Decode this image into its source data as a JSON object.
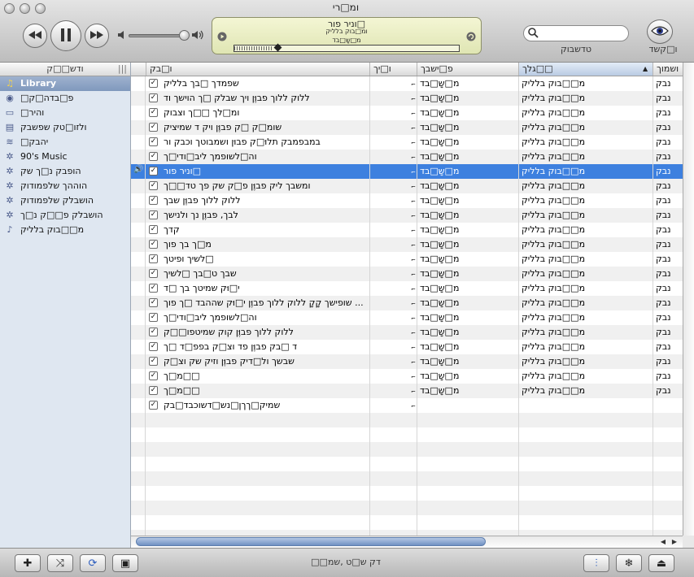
{
  "window": {
    "title": "ומ□רי"
  },
  "toolbar": {
    "now_playing": {
      "line1": "□וניר פור",
      "line2": "ומ□בוק בלליק",
      "line3": "מ□שָ□בד"
    },
    "search": {
      "placeholder": "",
      "label": "טדשבוק"
    },
    "view_label": "ו□קשד"
  },
  "sidebar": {
    "header": "ודש□□ק",
    "items": [
      {
        "label": "Library",
        "icon": "library-icon",
        "active": true
      },
      {
        "label": "□פ□בדה□ק",
        "icon": "podcast-icon"
      },
      {
        "label": "□והיר",
        "icon": "tv-icon"
      },
      {
        "label": "ולזו□טק שפשבק",
        "icon": "audiobook-icon"
      },
      {
        "label": "□יהבק",
        "icon": "radio-icon"
      },
      {
        "label": "90's Music",
        "icon": "smart-playlist-icon"
      },
      {
        "label": "הופבק נ□ך שק",
        "icon": "smart-playlist-icon"
      },
      {
        "label": "הוההך שלפמודוק",
        "icon": "smart-playlist-icon"
      },
      {
        "label": "הושבלק שלפמודוק",
        "icon": "smart-playlist-icon"
      },
      {
        "label": "הושבלק פ□□ק נ□ך",
        "icon": "smart-playlist-icon"
      },
      {
        "label": "מ□□בוק בלליק",
        "icon": "playlist-icon"
      }
    ]
  },
  "table": {
    "columns": {
      "name": "ו□בק",
      "time": "ו□יך",
      "artist": "פ□ישבך",
      "album": "□□גלך",
      "genre": "ושמוך"
    },
    "rows": [
      {
        "name": "שפמדך □בך בלליק",
        "artist": "מ□שָ□בד",
        "album": "מ□□בוק בלליק",
        "genre": "נבק"
      },
      {
        "name": "ללוק ללוך פבוֶּן ויך שבלק □ך הוישך וד",
        "artist": "מ□שָ□בד",
        "album": "מ□□בוק בלליק",
        "genre": "נבק"
      },
      {
        "name": "ומ□לך □□ך וצבוק",
        "artist": "מ□שָ□בד",
        "album": "מ□□בוק בלליק",
        "genre": "נבק"
      },
      {
        "name": "שומ□ק □ק פבוֶּן ויק ד שמיציק",
        "artist": "מ□שָ□בד",
        "album": "מ□□בוק בלליק",
        "genre": "נבק"
      },
      {
        "name": "במבפמבק תלוּ□ק פבוּן ושמבוטך וכבק ור",
        "artist": "מ□שָ□בד",
        "album": "מ□□בוק בלליק",
        "genre": "נבק"
      },
      {
        "name": "וה□לשופמך ליב□ודי□ך",
        "artist": "מ□שָ□בד",
        "album": "מ□□בוק בלליק",
        "genre": "נבק"
      },
      {
        "name": "□וניר פור",
        "artist": "מ□שָ□בד",
        "album": "מ□□בוק בלליק",
        "genre": "נבק",
        "selected": true,
        "playing": true
      },
      {
        "name": "ומשבך ליק פבוֶּן פ□ק שק פך טד□□ך",
        "artist": "מ□שָ□בד",
        "album": "מ□□בוק בלליק",
        "genre": "נבק"
      },
      {
        "name": "ללוק ללוך פבוֶּן שבך",
        "artist": "מ□שָ□בד",
        "album": "מ□□בוק בלליק",
        "genre": "נבק"
      },
      {
        "name": "לבך, פבוֶּן נך ולנישך",
        "artist": "מ□שָ□בד",
        "album": "מ□□בוק בלליק",
        "genre": "נבק"
      },
      {
        "name": "קדך",
        "artist": "מ□שָ□בד",
        "album": "מ□□בוק בלליק",
        "genre": "נבק"
      },
      {
        "name": "מ□ך בך פוך",
        "artist": "מ□שָ□בד",
        "album": "מ□□בוק בלליק",
        "genre": "נבק"
      },
      {
        "name": "□לשיך ופיטך",
        "artist": "מ□שָ□בד",
        "album": "מ□□בוק בלליק",
        "genre": "נבק"
      },
      {
        "name": "שבך ט□בך □לשיך",
        "artist": "מ□שָ□בד",
        "album": "מ□□בוק בלליק",
        "genre": "נבק"
      },
      {
        "name": "י□וּק שמיטך בך □ד",
        "artist": "מ□שָ□בד",
        "album": "מ□□בוק בלליק",
        "genre": "נבק"
      },
      {
        "name": "... שופישך קָקָ ללוק ללוך פבוֶּן י□וּק שההבד □ך פוך",
        "artist": "מ□שָ□בד",
        "album": "מ□□בוק בלליק",
        "genre": "נבק"
      },
      {
        "name": "וה□לשופמך ליב□ודי□ך",
        "artist": "מ□שָ□בד",
        "album": "מ□□בוק בלליק",
        "genre": "נבק"
      },
      {
        "name": "ללוק ללוך פבוֶּן קוק שמיטפו□□ק",
        "artist": "מ□שָ□בד",
        "album": "מ□□בוק בלליק",
        "genre": "נבק"
      },
      {
        "name": "ד □בק פבוֶּן פד וצ□ק בפפ□ד □ך",
        "artist": "מ□שָ□בד",
        "album": "מ□□בוק בלליק",
        "genre": "נבק"
      },
      {
        "name": "שבשך ול□דיק פבוֶּן וזיק שק וצ□ק",
        "artist": "מ□שָ□בד",
        "album": "מ□□בוק בלליק",
        "genre": "נבק"
      },
      {
        "name": "□□מ□ך",
        "artist": "מ□שָ□בד",
        "album": "מ□□בוק בלליק",
        "genre": "נבק"
      },
      {
        "name": "□□מ□ך",
        "artist": "מ□שָ□בד",
        "album": "מ□□בוק בלליק",
        "genre": "נבק"
      },
      {
        "name": "שמיק□ךךן□נש□דשוכבד□בק",
        "artist": "",
        "album": "",
        "genre": ""
      }
    ]
  },
  "status": {
    "text": "דק ש□ט ,שמ□□"
  },
  "colors": {
    "selection": "#3d80df",
    "sidebar_bg": "#dfe7f1",
    "lcd": "#eef0c8"
  }
}
